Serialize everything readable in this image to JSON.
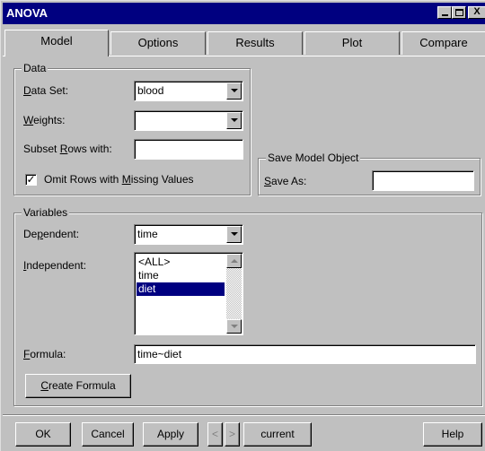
{
  "window": {
    "title": "ANOVA",
    "minimize_icon": "minimize-icon",
    "maximize_icon": "maximize-icon",
    "close_glyph": "X"
  },
  "tabs": [
    {
      "label": "Model",
      "active": true
    },
    {
      "label": "Options",
      "active": false
    },
    {
      "label": "Results",
      "active": false
    },
    {
      "label": "Plot",
      "active": false
    },
    {
      "label": "Compare",
      "active": false
    }
  ],
  "data_group": {
    "title": "Data",
    "data_set_label_u": "D",
    "data_set_label_rest": "ata Set:",
    "data_set_value": "blood",
    "weights_label_u": "W",
    "weights_label_rest": "eights:",
    "weights_value": "",
    "subset_label_pre": "Subset ",
    "subset_label_u": "R",
    "subset_label_rest": "ows with:",
    "subset_value": "",
    "omit_checked": true,
    "omit_check_glyph": "✓",
    "omit_label_pre": "Omit Rows with ",
    "omit_label_u": "M",
    "omit_label_rest": "issing Values"
  },
  "save_group": {
    "title": "Save Model Object",
    "save_as_label_u": "S",
    "save_as_label_rest": "ave As:",
    "save_as_value": ""
  },
  "variables_group": {
    "title": "Variables",
    "dependent_label_pre": "De",
    "dependent_label_u": "p",
    "dependent_label_rest": "endent:",
    "dependent_value": "time",
    "independent_label_u": "I",
    "independent_label_rest": "ndependent:",
    "independent_items": [
      "<ALL>",
      "time",
      "diet"
    ],
    "independent_selected": "diet",
    "formula_label_u": "F",
    "formula_label_rest": "ormula:",
    "formula_value": "time~diet",
    "create_formula_u": "C",
    "create_formula_rest": "reate Formula"
  },
  "footer": {
    "ok": "OK",
    "cancel": "Cancel",
    "apply": "Apply",
    "prev_glyph": "<",
    "next_glyph": ">",
    "current": "current",
    "help": "Help"
  },
  "colors": {
    "titlebar": "#000080",
    "face": "#c0c0c0",
    "selection": "#000080"
  }
}
